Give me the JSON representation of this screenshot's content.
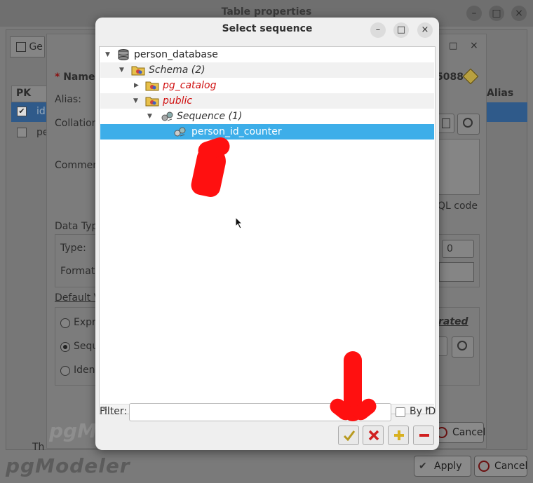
{
  "background_window": {
    "title": "Table properties",
    "tab_label": "Ge",
    "columns_header": {
      "pk": "PK",
      "alias": "Alias"
    },
    "row_labels": [
      "id",
      "pe"
    ],
    "apply_label": "Apply",
    "cancel_label": "Cancel",
    "brand_text": "pgModeler",
    "bottom_text": "Th"
  },
  "middle_dialog": {
    "name_label": "Name:",
    "name_required_mark": "*",
    "id_value": "5088",
    "alias_label": "Alias:",
    "collation_label": "Collation",
    "comment_label": "Commen",
    "sql_code_label": "QL code",
    "data_type_label": "Data Typ",
    "type_label": "Type:",
    "format_label": "Format",
    "spin_value": "0",
    "default_value_label": "Default V",
    "radio_expr": "Expr",
    "radio_sequence": "Sequ",
    "radio_identity": "Iden",
    "generated_label": "rated",
    "cancel_label": "Cancel",
    "brand_text": "pgMo"
  },
  "dialog": {
    "title": "Select sequence",
    "tree": [
      {
        "label": "person_database",
        "level": 0,
        "arrow": "expanded",
        "icon": "database-icon",
        "style": "normal"
      },
      {
        "label": "Schema (2)",
        "level": 1,
        "arrow": "expanded",
        "icon": "folder-icon",
        "style": "italic"
      },
      {
        "label": "pg_catalog",
        "level": 2,
        "arrow": "collapsed",
        "icon": "schema-icon",
        "style": "red"
      },
      {
        "label": "public",
        "level": 2,
        "arrow": "expanded",
        "icon": "schema-icon",
        "style": "red"
      },
      {
        "label": "Sequence (1)",
        "level": 3,
        "arrow": "expanded",
        "icon": "sequence-icon",
        "style": "italic"
      },
      {
        "label": "person_id_counter",
        "level": 4,
        "arrow": "none",
        "icon": "sequence-icon",
        "style": "selected"
      }
    ],
    "filter_label": "Filter:",
    "filter_value": "",
    "by_id_label": "By ID",
    "colors": {
      "selection": "#3daee9",
      "annotation": "#ff1010"
    }
  }
}
